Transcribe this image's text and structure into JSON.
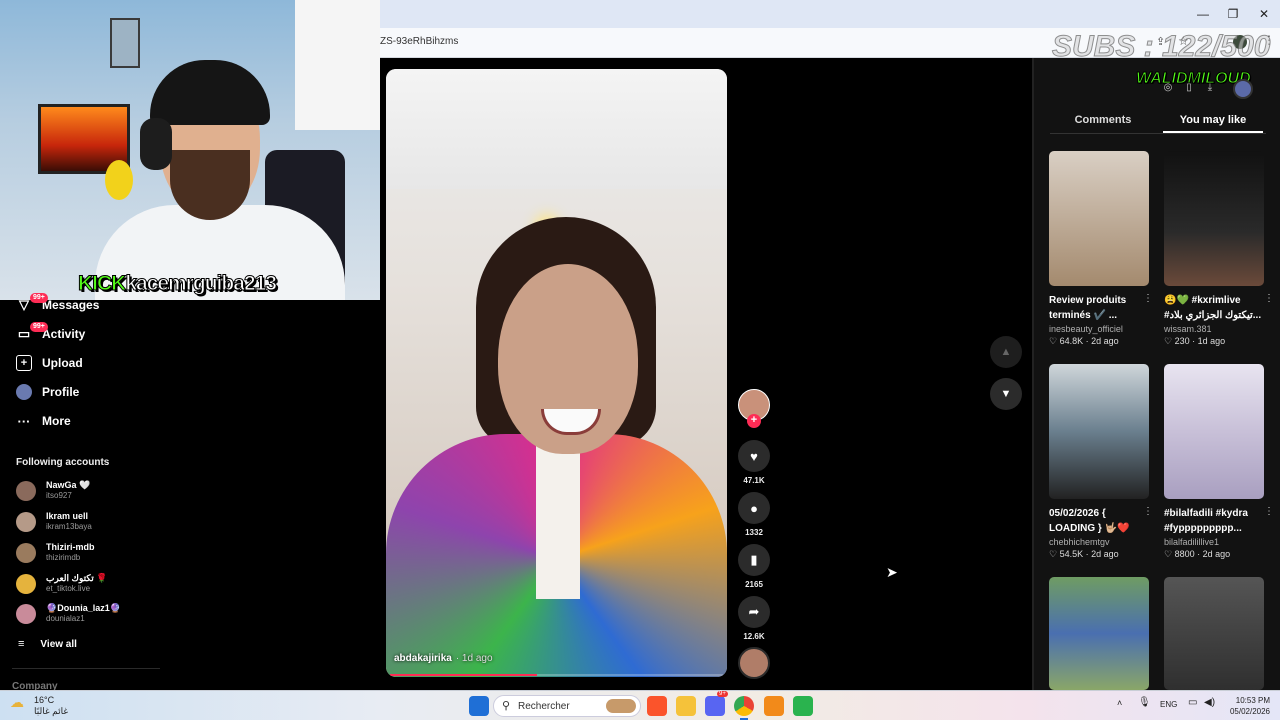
{
  "browser": {
    "url_fragment": "ZS-93eRhBihzms"
  },
  "stream_overlay": {
    "kick_label": "KICK",
    "kick_username": "kacemrguiba213",
    "subs_goal": "SUBS : 122/500",
    "streamer_name": "WALIDMILOUD"
  },
  "sidebar": {
    "items": [
      {
        "label": "Messages",
        "icon": "message-icon",
        "badge": "99+"
      },
      {
        "label": "Activity",
        "icon": "activity-icon",
        "badge": "99+"
      },
      {
        "label": "Upload",
        "icon": "upload-icon"
      },
      {
        "label": "Profile",
        "icon": "profile-icon"
      },
      {
        "label": "More",
        "icon": "more-icon"
      }
    ],
    "following_title": "Following accounts",
    "following": [
      {
        "name": "NawGa 🤍",
        "handle": "itso927",
        "color": "#8a6a5c"
      },
      {
        "name": "Ikram uell",
        "handle": "ikram13baya",
        "color": "#b59a88"
      },
      {
        "name": "Thiziri-mdb",
        "handle": "thizirimdb",
        "color": "#9a7b5e"
      },
      {
        "name": "تكتوك العرب 🌹",
        "handle": "et_tiktok.live",
        "color": "#e5b33d"
      },
      {
        "name": "🔮Dounia_laz1🔮",
        "handle": "dounialaz1",
        "color": "#c98b9a"
      }
    ],
    "view_all": "View all",
    "company": "Company"
  },
  "video": {
    "author": "abdakajirika",
    "age": "1d ago",
    "likes": "47.1K",
    "comments": "1332",
    "saves": "2165",
    "shares": "12.6K",
    "progress": 0.44
  },
  "right_panel": {
    "tabs": [
      "Comments",
      "You may like"
    ],
    "active_tab": "You may like",
    "cards": [
      {
        "title": "Review produits",
        "title2": "terminés ✔️ ...",
        "user": "inesbeauty_officiel",
        "stats": "♡ 64.8K · 2d ago",
        "color": "#b8a28a"
      },
      {
        "title": "😩💚 #kxrimlive",
        "title2": "#تيكتوك الجزائري بلاد...",
        "user": "wissam.381",
        "stats": "♡ 230 · 1d ago",
        "color": "#1c1c1c"
      },
      {
        "title": "05/02/2026 {",
        "title2": "LOADING } 🤟🏼❤️",
        "user": "chebhichemtgv",
        "stats": "♡ 54.5K · 2d ago",
        "color": "#6a7f8e"
      },
      {
        "title": "#bilalfadili #kydra",
        "title2": "#fyppppppppp...",
        "user": "bilalfadilillive1",
        "stats": "♡ 8800 · 2d ago",
        "color": "#c8c0d8"
      },
      {
        "title": "",
        "title2": "",
        "user": "",
        "stats": "",
        "color": "#5b8f5a"
      },
      {
        "title": "",
        "title2": "",
        "user": "",
        "stats": "",
        "color": "#3a3a3a"
      }
    ]
  },
  "taskbar": {
    "temperature": "16°C",
    "weather_text": "غائم غالبًا",
    "search_placeholder": "Rechercher",
    "language": "ENG",
    "time": "10:53 PM",
    "date": "05/02/2026",
    "discord_badge": "9+"
  }
}
